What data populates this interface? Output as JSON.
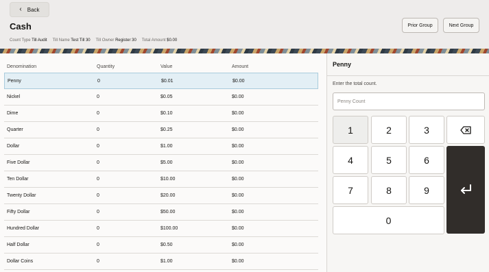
{
  "header": {
    "back_label": "Back",
    "title": "Cash",
    "meta": [
      {
        "label": "Count Type",
        "value": "Till Audit"
      },
      {
        "label": "Till Name",
        "value": "Test Till 30"
      },
      {
        "label": "Till Owner",
        "value": "Register 30"
      },
      {
        "label": "Total Amount",
        "value": "$0.00"
      }
    ],
    "prior_label": "Prior Group",
    "next_label": "Next Group"
  },
  "table": {
    "columns": [
      "Denomination",
      "Quantity",
      "Value",
      "Amount"
    ],
    "rows": [
      {
        "denomination": "Penny",
        "quantity": "0",
        "value": "$0.01",
        "amount": "$0.00"
      },
      {
        "denomination": "Nickel",
        "quantity": "0",
        "value": "$0.05",
        "amount": "$0.00"
      },
      {
        "denomination": "Dime",
        "quantity": "0",
        "value": "$0.10",
        "amount": "$0.00"
      },
      {
        "denomination": "Quarter",
        "quantity": "0",
        "value": "$0.25",
        "amount": "$0.00"
      },
      {
        "denomination": "Dollar",
        "quantity": "0",
        "value": "$1.00",
        "amount": "$0.00"
      },
      {
        "denomination": "Five Dollar",
        "quantity": "0",
        "value": "$5.00",
        "amount": "$0.00"
      },
      {
        "denomination": "Ten Dollar",
        "quantity": "0",
        "value": "$10.00",
        "amount": "$0.00"
      },
      {
        "denomination": "Twenty Dollar",
        "quantity": "0",
        "value": "$20.00",
        "amount": "$0.00"
      },
      {
        "denomination": "Fifty Dollar",
        "quantity": "0",
        "value": "$50.00",
        "amount": "$0.00"
      },
      {
        "denomination": "Hundred Dollar",
        "quantity": "0",
        "value": "$100.00",
        "amount": "$0.00"
      },
      {
        "denomination": "Half Dollar",
        "quantity": "0",
        "value": "$0.50",
        "amount": "$0.00"
      },
      {
        "denomination": "Dollar Coins",
        "quantity": "0",
        "value": "$1.00",
        "amount": "$0.00"
      }
    ]
  },
  "entry": {
    "title": "Penny",
    "prompt": "Enter the total count.",
    "input_value": "",
    "input_placeholder": "Penny Count"
  },
  "keypad": {
    "keys": [
      "1",
      "2",
      "3",
      "4",
      "5",
      "6",
      "7",
      "8",
      "9",
      "0"
    ],
    "backspace_icon": "backspace-icon",
    "enter_icon": "enter-icon"
  }
}
